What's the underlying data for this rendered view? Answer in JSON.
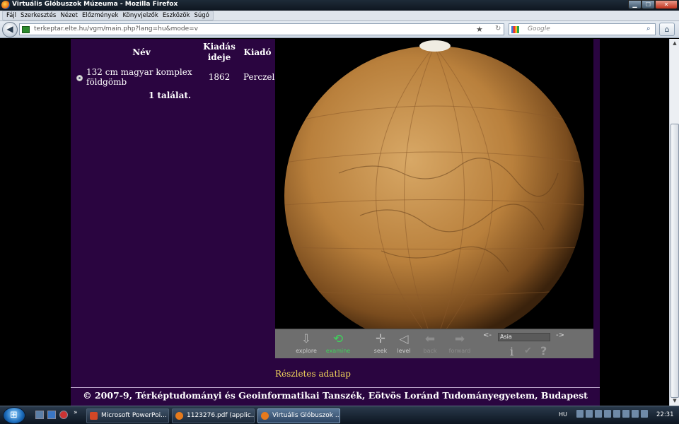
{
  "window": {
    "title": "Virtuális Glóbuszok Múzeuma - Mozilla Firefox",
    "controls": {
      "minimize": "▁",
      "maximize": "☐",
      "close": "✕"
    }
  },
  "menu": [
    "Fájl",
    "Szerkesztés",
    "Nézet",
    "Előzmények",
    "Könyvjelzők",
    "Eszközök",
    "Súgó"
  ],
  "navbar": {
    "url": "terkeptar.elte.hu/vgm/main.php?lang=hu&mode=v",
    "search_placeholder": "Google"
  },
  "results": {
    "headers": {
      "name": "Név",
      "date_line1": "Kiadás",
      "date_line2": "ideje",
      "publisher": "Kiadó"
    },
    "rows": [
      {
        "name": "132 cm magyar komplex földgömb",
        "date": "1862",
        "publisher": "Perczel"
      }
    ],
    "count": "1 találat."
  },
  "viewer": {
    "tools": {
      "explore": "explore",
      "examine": "examine",
      "seek": "seek",
      "level": "level",
      "back": "back",
      "forward": "forward"
    },
    "prev": "<-",
    "next": "->",
    "view_selection": "Asia",
    "info": "i",
    "confirm": "✔",
    "help": "?",
    "active_tool": "examine"
  },
  "details_link": "Részletes adatlap",
  "footer": "© 2007-9, Térképtudományi és Geoinformatikai Tanszék, Eötvös Loránd Tudományegyetem, Budapest",
  "taskbar": {
    "tasks": [
      {
        "label": "Microsoft PowerPoi...",
        "active": false
      },
      {
        "label": "1123276.pdf (applic...",
        "active": false
      },
      {
        "label": "Virtuális Glóbuszok ...",
        "active": true
      }
    ],
    "more": "»",
    "language": "HU",
    "clock": "22:31"
  },
  "colors": {
    "page_background": "#2a0540",
    "link": "#f4d65b",
    "active_tool": "#3fd35b",
    "globe": "#c8904a"
  }
}
